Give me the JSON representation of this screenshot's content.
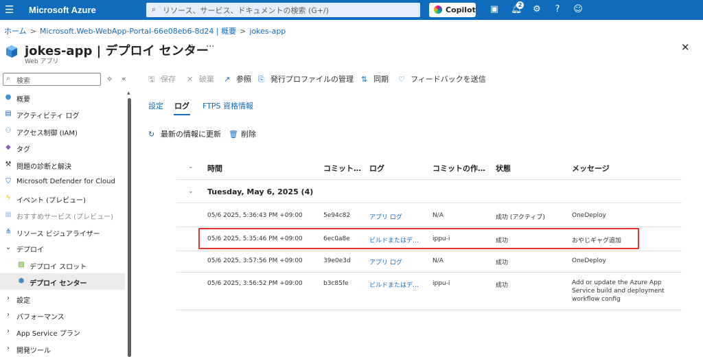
{
  "topbar": {
    "brand": "Microsoft Azure",
    "search_placeholder": "リソース、サービス、ドキュメントの検索 (G+/)",
    "copilot_label": "Copilot",
    "notifications_count": "2",
    "icons": [
      "cloud-shell-icon",
      "bell-icon",
      "settings-icon",
      "help-icon",
      "feedback-icon"
    ]
  },
  "breadcrumb": [
    "ホーム",
    "Microsoft.Web-WebApp-Portal-66e08eb6-8d24 | 概要",
    "jokes-app"
  ],
  "header": {
    "title": "jokes-app | デプロイ センター",
    "subtitle": "Web アプリ"
  },
  "sidebar": {
    "search_placeholder": "検索",
    "items": [
      {
        "label": "概要",
        "icon": "globe-icon"
      },
      {
        "label": "アクティビティ ログ",
        "icon": "activity-log-icon"
      },
      {
        "label": "アクセス制御 (IAM)",
        "icon": "iam-icon"
      },
      {
        "label": "タグ",
        "icon": "tag-icon"
      },
      {
        "label": "問題の診断と解決",
        "icon": "wrench-icon"
      },
      {
        "label": "Microsoft Defender for Cloud",
        "icon": "shield-icon"
      },
      {
        "label": "イベント (プレビュー)",
        "icon": "lightning-icon"
      },
      {
        "label": "おすすめサービス (プレビュー)",
        "icon": "grid-icon"
      },
      {
        "label": "リソース ビジュアライザー",
        "icon": "visualizer-icon"
      },
      {
        "label": "デプロイ",
        "icon": "chevron-down-icon"
      },
      {
        "label": "デプロイ スロット",
        "icon": "slots-icon"
      },
      {
        "label": "デプロイ センター",
        "icon": "deployment-center-icon"
      },
      {
        "label": "設定",
        "icon": "chevron-right-icon"
      },
      {
        "label": "パフォーマンス",
        "icon": "chevron-right-icon"
      },
      {
        "label": "App Service プラン",
        "icon": "chevron-right-icon"
      },
      {
        "label": "開発ツール",
        "icon": "chevron-right-icon"
      }
    ]
  },
  "toolbar": {
    "save": "保存",
    "discard": "破棄",
    "browse": "参照",
    "manage_profile": "発行プロファイルの管理",
    "sync": "同期",
    "feedback": "フィードバックを送信"
  },
  "tabs": [
    "設定",
    "ログ",
    "FTPS 資格情報"
  ],
  "actions": {
    "refresh": "最新の情報に更新",
    "delete": "削除"
  },
  "table": {
    "columns": [
      "時間",
      "コミット…",
      "ログ",
      "コミットの作…",
      "状態",
      "メッセージ"
    ],
    "group_label": "Tuesday, May 6, 2025 (4)",
    "rows": [
      {
        "time": "05/6 2025, 5:36:43 PM +09:00",
        "commit": "5e94c82",
        "log": "アプリ ログ",
        "author": "N/A",
        "status": "成功 (アクティブ)",
        "message": "OneDeploy"
      },
      {
        "time": "05/6 2025, 5:35:46 PM +09:00",
        "commit": "6ec0a8e",
        "log": "ビルドまたはデ…",
        "author": "ippu-i",
        "status": "成功",
        "message": "おやじギャグ追加"
      },
      {
        "time": "05/6 2025, 3:57:56 PM +09:00",
        "commit": "39e0e3d",
        "log": "アプリ ログ",
        "author": "N/A",
        "status": "成功",
        "message": "OneDeploy"
      },
      {
        "time": "05/6 2025, 3:56:52 PM +09:00",
        "commit": "b3c85fe",
        "log": "ビルドまたはデ…",
        "author": "ippu-i",
        "status": "成功",
        "message": "Add or update the Azure App Service build and deployment workflow config"
      }
    ]
  },
  "colors": {
    "accent": "#0f6cbd",
    "highlight": "#e5322d"
  }
}
